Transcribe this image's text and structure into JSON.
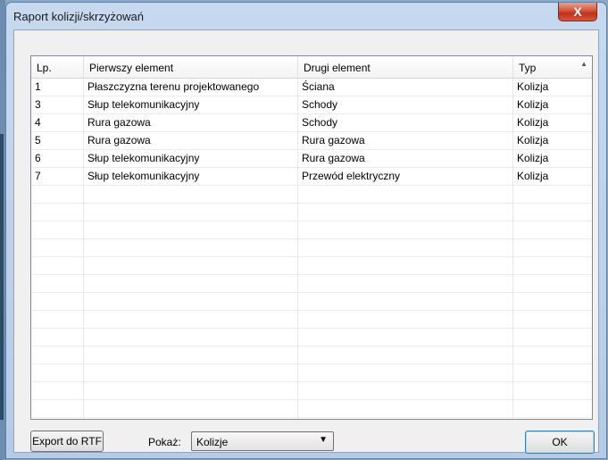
{
  "window": {
    "title": "Raport kolizji/skrzyżowań",
    "close_glyph": "X"
  },
  "table": {
    "columns": [
      "Lp.",
      "Pierwszy element",
      "Drugi element",
      "Typ"
    ],
    "rows": [
      [
        "1",
        "Płaszczyzna terenu projektowanego",
        "Ściana",
        "Kolizja"
      ],
      [
        "3",
        "Słup telekomunikacyjny",
        "Schody",
        "Kolizja"
      ],
      [
        "4",
        "Rura gazowa",
        "Schody",
        "Kolizja"
      ],
      [
        "5",
        "Rura gazowa",
        "Rura gazowa",
        "Kolizja"
      ],
      [
        "6",
        "Słup telekomunikacyjny",
        "Rura gazowa",
        "Kolizja"
      ],
      [
        "7",
        "Słup telekomunikacyjny",
        "Przewód elektryczny",
        "Kolizja"
      ]
    ],
    "empty_rows": 14
  },
  "footer": {
    "export_label": "Export do RTF",
    "show_label": "Pokaż:",
    "show_value": "Kolizje",
    "ok_label": "OK"
  },
  "icons": {
    "close": "close-icon",
    "dropdown": "chevron-down-icon",
    "sort": "sort-up-icon"
  }
}
